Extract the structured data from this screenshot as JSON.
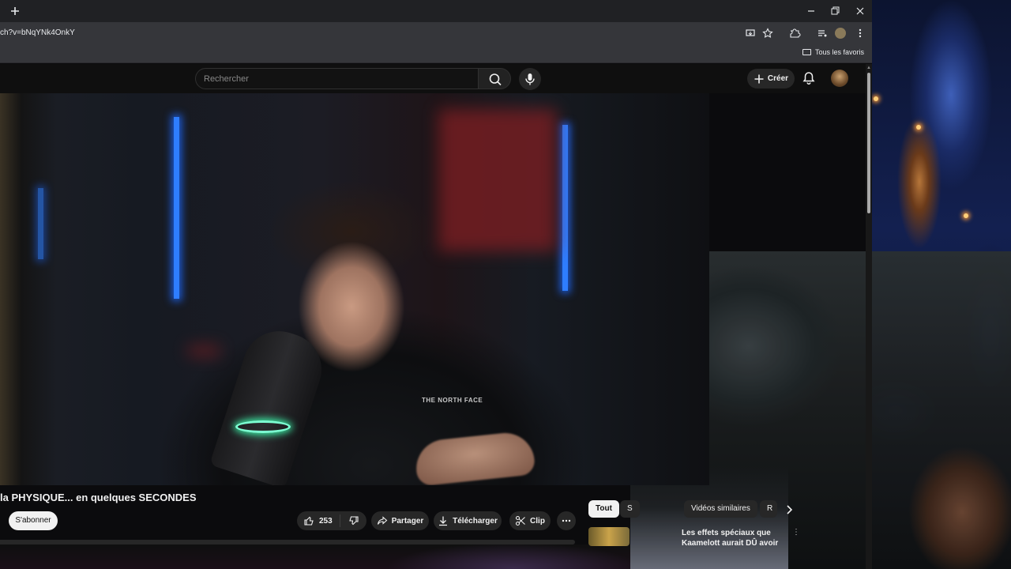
{
  "browser": {
    "new_tab_icon": "plus-icon",
    "url": "ch?v=bNqYNk4OnkY",
    "bookmarks_bar": {
      "all_bookmarks": "Tous les favoris"
    }
  },
  "youtube": {
    "search": {
      "placeholder": "Rechercher"
    },
    "header": {
      "create_label": "Créer"
    },
    "video": {
      "title": "la PHYSIQUE... en quelques SECONDES",
      "shirt_logo": "THE NORTH FACE"
    },
    "channel": {
      "subscribe_label": "S'abonner"
    },
    "actions": {
      "like_count": "253",
      "share_label": "Partager",
      "download_label": "Télécharger",
      "clip_label": "Clip"
    },
    "chips": {
      "all": "Tout",
      "second": "S",
      "similar": "Vidéos similaires",
      "fourth": "R"
    },
    "recommendation": {
      "title_line1": "Les effets spéciaux que",
      "title_line2": "Kaamelott aurait DÛ avoir",
      "more": "⋮"
    }
  },
  "colors": {
    "youtube_bg": "#0f0f0f",
    "chrome_tab_bg": "#202124",
    "chrome_toolbar_bg": "#35363a",
    "chip_active_bg": "#f1f1f1",
    "button_bg": "#272727",
    "led_blue": "#2e7dff",
    "mic_ring": "#7cffd2"
  }
}
